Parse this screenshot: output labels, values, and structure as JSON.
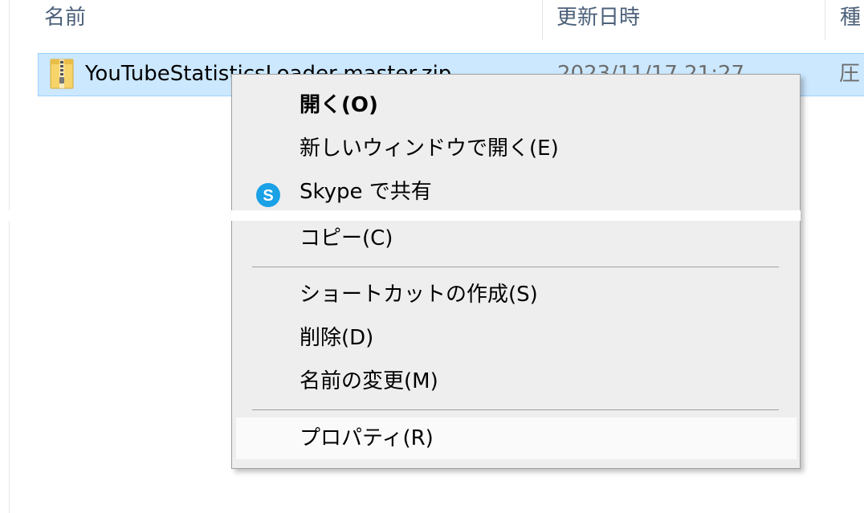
{
  "columns": {
    "name": "名前",
    "date": "更新日時",
    "type": "種"
  },
  "file": {
    "icon": "zip-folder-icon",
    "name": "YouTubeStatisticsLoader-master.zip",
    "date": "2023/11/17 21:27",
    "type": "圧"
  },
  "context_menu": {
    "items": [
      {
        "label": "開く(O)",
        "bold": true
      },
      {
        "label": "新しいウィンドウで開く(E)"
      },
      {
        "label": "Skype で共有",
        "icon": "skype-icon"
      },
      {
        "label": "コピー(C)"
      },
      {
        "label": "ショートカットの作成(S)"
      },
      {
        "label": "削除(D)"
      },
      {
        "label": "名前の変更(M)"
      },
      {
        "label": "プロパティ(R)",
        "hovered": true
      }
    ]
  },
  "colors": {
    "selection_bg": "#cce8ff",
    "selection_border": "#99d1ff",
    "menu_bg": "#eeeeee",
    "skype_blue": "#1aa1e6",
    "header_text": "#4c607a"
  }
}
